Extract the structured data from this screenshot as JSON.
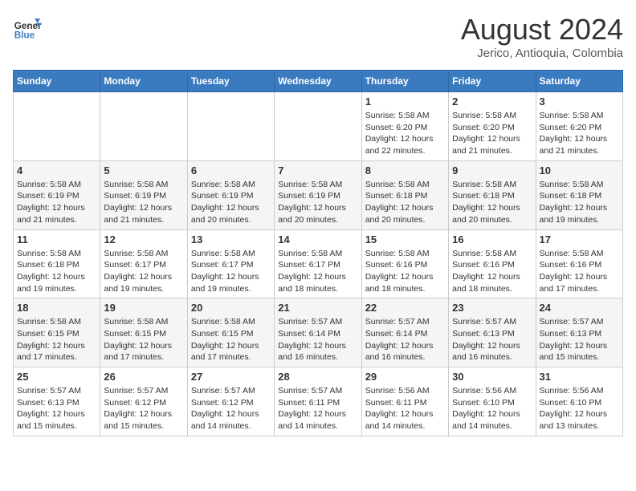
{
  "logo": {
    "line1": "General",
    "line2": "Blue"
  },
  "title": "August 2024",
  "subtitle": "Jerico, Antioquia, Colombia",
  "weekdays": [
    "Sunday",
    "Monday",
    "Tuesday",
    "Wednesday",
    "Thursday",
    "Friday",
    "Saturday"
  ],
  "weeks": [
    [
      {
        "day": "",
        "info": ""
      },
      {
        "day": "",
        "info": ""
      },
      {
        "day": "",
        "info": ""
      },
      {
        "day": "",
        "info": ""
      },
      {
        "day": "1",
        "info": "Sunrise: 5:58 AM\nSunset: 6:20 PM\nDaylight: 12 hours\nand 22 minutes."
      },
      {
        "day": "2",
        "info": "Sunrise: 5:58 AM\nSunset: 6:20 PM\nDaylight: 12 hours\nand 21 minutes."
      },
      {
        "day": "3",
        "info": "Sunrise: 5:58 AM\nSunset: 6:20 PM\nDaylight: 12 hours\nand 21 minutes."
      }
    ],
    [
      {
        "day": "4",
        "info": "Sunrise: 5:58 AM\nSunset: 6:19 PM\nDaylight: 12 hours\nand 21 minutes."
      },
      {
        "day": "5",
        "info": "Sunrise: 5:58 AM\nSunset: 6:19 PM\nDaylight: 12 hours\nand 21 minutes."
      },
      {
        "day": "6",
        "info": "Sunrise: 5:58 AM\nSunset: 6:19 PM\nDaylight: 12 hours\nand 20 minutes."
      },
      {
        "day": "7",
        "info": "Sunrise: 5:58 AM\nSunset: 6:19 PM\nDaylight: 12 hours\nand 20 minutes."
      },
      {
        "day": "8",
        "info": "Sunrise: 5:58 AM\nSunset: 6:18 PM\nDaylight: 12 hours\nand 20 minutes."
      },
      {
        "day": "9",
        "info": "Sunrise: 5:58 AM\nSunset: 6:18 PM\nDaylight: 12 hours\nand 20 minutes."
      },
      {
        "day": "10",
        "info": "Sunrise: 5:58 AM\nSunset: 6:18 PM\nDaylight: 12 hours\nand 19 minutes."
      }
    ],
    [
      {
        "day": "11",
        "info": "Sunrise: 5:58 AM\nSunset: 6:18 PM\nDaylight: 12 hours\nand 19 minutes."
      },
      {
        "day": "12",
        "info": "Sunrise: 5:58 AM\nSunset: 6:17 PM\nDaylight: 12 hours\nand 19 minutes."
      },
      {
        "day": "13",
        "info": "Sunrise: 5:58 AM\nSunset: 6:17 PM\nDaylight: 12 hours\nand 19 minutes."
      },
      {
        "day": "14",
        "info": "Sunrise: 5:58 AM\nSunset: 6:17 PM\nDaylight: 12 hours\nand 18 minutes."
      },
      {
        "day": "15",
        "info": "Sunrise: 5:58 AM\nSunset: 6:16 PM\nDaylight: 12 hours\nand 18 minutes."
      },
      {
        "day": "16",
        "info": "Sunrise: 5:58 AM\nSunset: 6:16 PM\nDaylight: 12 hours\nand 18 minutes."
      },
      {
        "day": "17",
        "info": "Sunrise: 5:58 AM\nSunset: 6:16 PM\nDaylight: 12 hours\nand 17 minutes."
      }
    ],
    [
      {
        "day": "18",
        "info": "Sunrise: 5:58 AM\nSunset: 6:15 PM\nDaylight: 12 hours\nand 17 minutes."
      },
      {
        "day": "19",
        "info": "Sunrise: 5:58 AM\nSunset: 6:15 PM\nDaylight: 12 hours\nand 17 minutes."
      },
      {
        "day": "20",
        "info": "Sunrise: 5:58 AM\nSunset: 6:15 PM\nDaylight: 12 hours\nand 17 minutes."
      },
      {
        "day": "21",
        "info": "Sunrise: 5:57 AM\nSunset: 6:14 PM\nDaylight: 12 hours\nand 16 minutes."
      },
      {
        "day": "22",
        "info": "Sunrise: 5:57 AM\nSunset: 6:14 PM\nDaylight: 12 hours\nand 16 minutes."
      },
      {
        "day": "23",
        "info": "Sunrise: 5:57 AM\nSunset: 6:13 PM\nDaylight: 12 hours\nand 16 minutes."
      },
      {
        "day": "24",
        "info": "Sunrise: 5:57 AM\nSunset: 6:13 PM\nDaylight: 12 hours\nand 15 minutes."
      }
    ],
    [
      {
        "day": "25",
        "info": "Sunrise: 5:57 AM\nSunset: 6:13 PM\nDaylight: 12 hours\nand 15 minutes."
      },
      {
        "day": "26",
        "info": "Sunrise: 5:57 AM\nSunset: 6:12 PM\nDaylight: 12 hours\nand 15 minutes."
      },
      {
        "day": "27",
        "info": "Sunrise: 5:57 AM\nSunset: 6:12 PM\nDaylight: 12 hours\nand 14 minutes."
      },
      {
        "day": "28",
        "info": "Sunrise: 5:57 AM\nSunset: 6:11 PM\nDaylight: 12 hours\nand 14 minutes."
      },
      {
        "day": "29",
        "info": "Sunrise: 5:56 AM\nSunset: 6:11 PM\nDaylight: 12 hours\nand 14 minutes."
      },
      {
        "day": "30",
        "info": "Sunrise: 5:56 AM\nSunset: 6:10 PM\nDaylight: 12 hours\nand 14 minutes."
      },
      {
        "day": "31",
        "info": "Sunrise: 5:56 AM\nSunset: 6:10 PM\nDaylight: 12 hours\nand 13 minutes."
      }
    ]
  ]
}
